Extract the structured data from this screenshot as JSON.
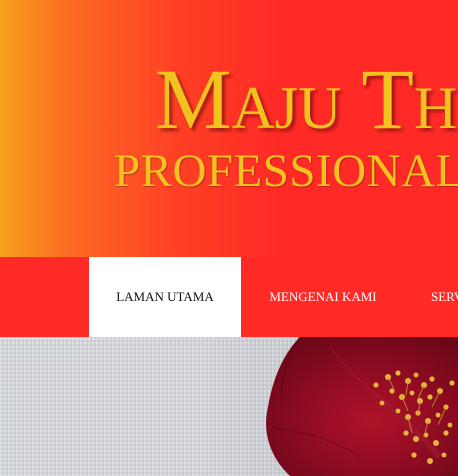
{
  "brand": {
    "title": "Maju Th",
    "subtitle": "PROFESSIONAL"
  },
  "nav": {
    "items": [
      {
        "label": "LAMAN UTAMA",
        "active": true
      },
      {
        "label": "MENGENAI KAMI",
        "active": false
      },
      {
        "label": "SERV",
        "active": false
      }
    ]
  },
  "hero": {
    "image": "red-hibiscus-flower"
  },
  "colors": {
    "header_gradient_start": "#f7a11f",
    "header_red": "#ff2a26",
    "brand_gold": "#f2c21f",
    "nav_active_bg": "#ffffff",
    "nav_text": "#ffffff"
  }
}
